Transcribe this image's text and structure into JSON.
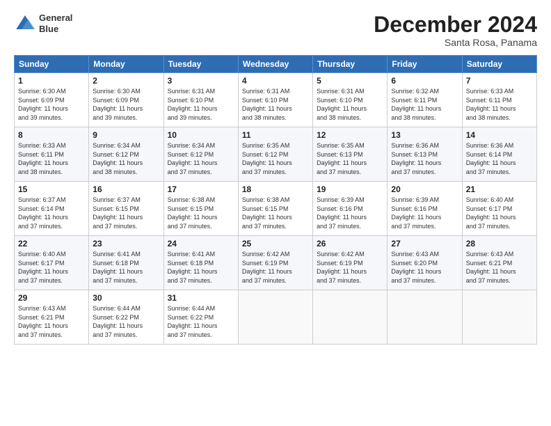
{
  "header": {
    "logo_line1": "General",
    "logo_line2": "Blue",
    "month_title": "December 2024",
    "subtitle": "Santa Rosa, Panama"
  },
  "days_of_week": [
    "Sunday",
    "Monday",
    "Tuesday",
    "Wednesday",
    "Thursday",
    "Friday",
    "Saturday"
  ],
  "weeks": [
    [
      {
        "day": "1",
        "info": "Sunrise: 6:30 AM\nSunset: 6:09 PM\nDaylight: 11 hours\nand 39 minutes."
      },
      {
        "day": "2",
        "info": "Sunrise: 6:30 AM\nSunset: 6:09 PM\nDaylight: 11 hours\nand 39 minutes."
      },
      {
        "day": "3",
        "info": "Sunrise: 6:31 AM\nSunset: 6:10 PM\nDaylight: 11 hours\nand 39 minutes."
      },
      {
        "day": "4",
        "info": "Sunrise: 6:31 AM\nSunset: 6:10 PM\nDaylight: 11 hours\nand 38 minutes."
      },
      {
        "day": "5",
        "info": "Sunrise: 6:31 AM\nSunset: 6:10 PM\nDaylight: 11 hours\nand 38 minutes."
      },
      {
        "day": "6",
        "info": "Sunrise: 6:32 AM\nSunset: 6:11 PM\nDaylight: 11 hours\nand 38 minutes."
      },
      {
        "day": "7",
        "info": "Sunrise: 6:33 AM\nSunset: 6:11 PM\nDaylight: 11 hours\nand 38 minutes."
      }
    ],
    [
      {
        "day": "8",
        "info": "Sunrise: 6:33 AM\nSunset: 6:11 PM\nDaylight: 11 hours\nand 38 minutes."
      },
      {
        "day": "9",
        "info": "Sunrise: 6:34 AM\nSunset: 6:12 PM\nDaylight: 11 hours\nand 38 minutes."
      },
      {
        "day": "10",
        "info": "Sunrise: 6:34 AM\nSunset: 6:12 PM\nDaylight: 11 hours\nand 37 minutes."
      },
      {
        "day": "11",
        "info": "Sunrise: 6:35 AM\nSunset: 6:12 PM\nDaylight: 11 hours\nand 37 minutes."
      },
      {
        "day": "12",
        "info": "Sunrise: 6:35 AM\nSunset: 6:13 PM\nDaylight: 11 hours\nand 37 minutes."
      },
      {
        "day": "13",
        "info": "Sunrise: 6:36 AM\nSunset: 6:13 PM\nDaylight: 11 hours\nand 37 minutes."
      },
      {
        "day": "14",
        "info": "Sunrise: 6:36 AM\nSunset: 6:14 PM\nDaylight: 11 hours\nand 37 minutes."
      }
    ],
    [
      {
        "day": "15",
        "info": "Sunrise: 6:37 AM\nSunset: 6:14 PM\nDaylight: 11 hours\nand 37 minutes."
      },
      {
        "day": "16",
        "info": "Sunrise: 6:37 AM\nSunset: 6:15 PM\nDaylight: 11 hours\nand 37 minutes."
      },
      {
        "day": "17",
        "info": "Sunrise: 6:38 AM\nSunset: 6:15 PM\nDaylight: 11 hours\nand 37 minutes."
      },
      {
        "day": "18",
        "info": "Sunrise: 6:38 AM\nSunset: 6:15 PM\nDaylight: 11 hours\nand 37 minutes."
      },
      {
        "day": "19",
        "info": "Sunrise: 6:39 AM\nSunset: 6:16 PM\nDaylight: 11 hours\nand 37 minutes."
      },
      {
        "day": "20",
        "info": "Sunrise: 6:39 AM\nSunset: 6:16 PM\nDaylight: 11 hours\nand 37 minutes."
      },
      {
        "day": "21",
        "info": "Sunrise: 6:40 AM\nSunset: 6:17 PM\nDaylight: 11 hours\nand 37 minutes."
      }
    ],
    [
      {
        "day": "22",
        "info": "Sunrise: 6:40 AM\nSunset: 6:17 PM\nDaylight: 11 hours\nand 37 minutes."
      },
      {
        "day": "23",
        "info": "Sunrise: 6:41 AM\nSunset: 6:18 PM\nDaylight: 11 hours\nand 37 minutes."
      },
      {
        "day": "24",
        "info": "Sunrise: 6:41 AM\nSunset: 6:18 PM\nDaylight: 11 hours\nand 37 minutes."
      },
      {
        "day": "25",
        "info": "Sunrise: 6:42 AM\nSunset: 6:19 PM\nDaylight: 11 hours\nand 37 minutes."
      },
      {
        "day": "26",
        "info": "Sunrise: 6:42 AM\nSunset: 6:19 PM\nDaylight: 11 hours\nand 37 minutes."
      },
      {
        "day": "27",
        "info": "Sunrise: 6:43 AM\nSunset: 6:20 PM\nDaylight: 11 hours\nand 37 minutes."
      },
      {
        "day": "28",
        "info": "Sunrise: 6:43 AM\nSunset: 6:21 PM\nDaylight: 11 hours\nand 37 minutes."
      }
    ],
    [
      {
        "day": "29",
        "info": "Sunrise: 6:43 AM\nSunset: 6:21 PM\nDaylight: 11 hours\nand 37 minutes."
      },
      {
        "day": "30",
        "info": "Sunrise: 6:44 AM\nSunset: 6:22 PM\nDaylight: 11 hours\nand 37 minutes."
      },
      {
        "day": "31",
        "info": "Sunrise: 6:44 AM\nSunset: 6:22 PM\nDaylight: 11 hours\nand 37 minutes."
      },
      null,
      null,
      null,
      null
    ]
  ]
}
